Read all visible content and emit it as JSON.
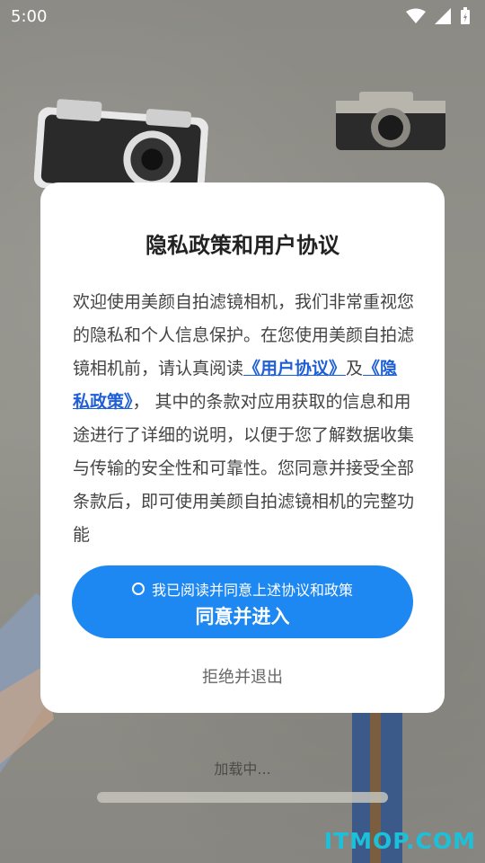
{
  "status": {
    "time": "5:00"
  },
  "dialog": {
    "title": "隐私政策和用户协议",
    "text_part1": "欢迎使用美颜自拍滤镜相机，我们非常重视您的隐私和个人信息保护。在您使用美颜自拍滤镜相机前，请认真阅读",
    "link_user_agreement": "《用户协议》",
    "text_and": "及",
    "link_privacy_policy": "《隐私政策》",
    "text_part2": "， 其中的条款对应用获取的信息和用途进行了详细的说明，以便于您了解数据收集与传输的安全性和可靠性。您同意并接受全部条款后，即可使用美颜自拍滤镜相机的完整功能",
    "agree_checkbox_label": "我已阅读并同意上述协议和政策",
    "agree_button": "同意并进入",
    "reject_button": "拒绝并退出"
  },
  "loading_text": "加载中...",
  "watermark": "ITMOP.COM"
}
